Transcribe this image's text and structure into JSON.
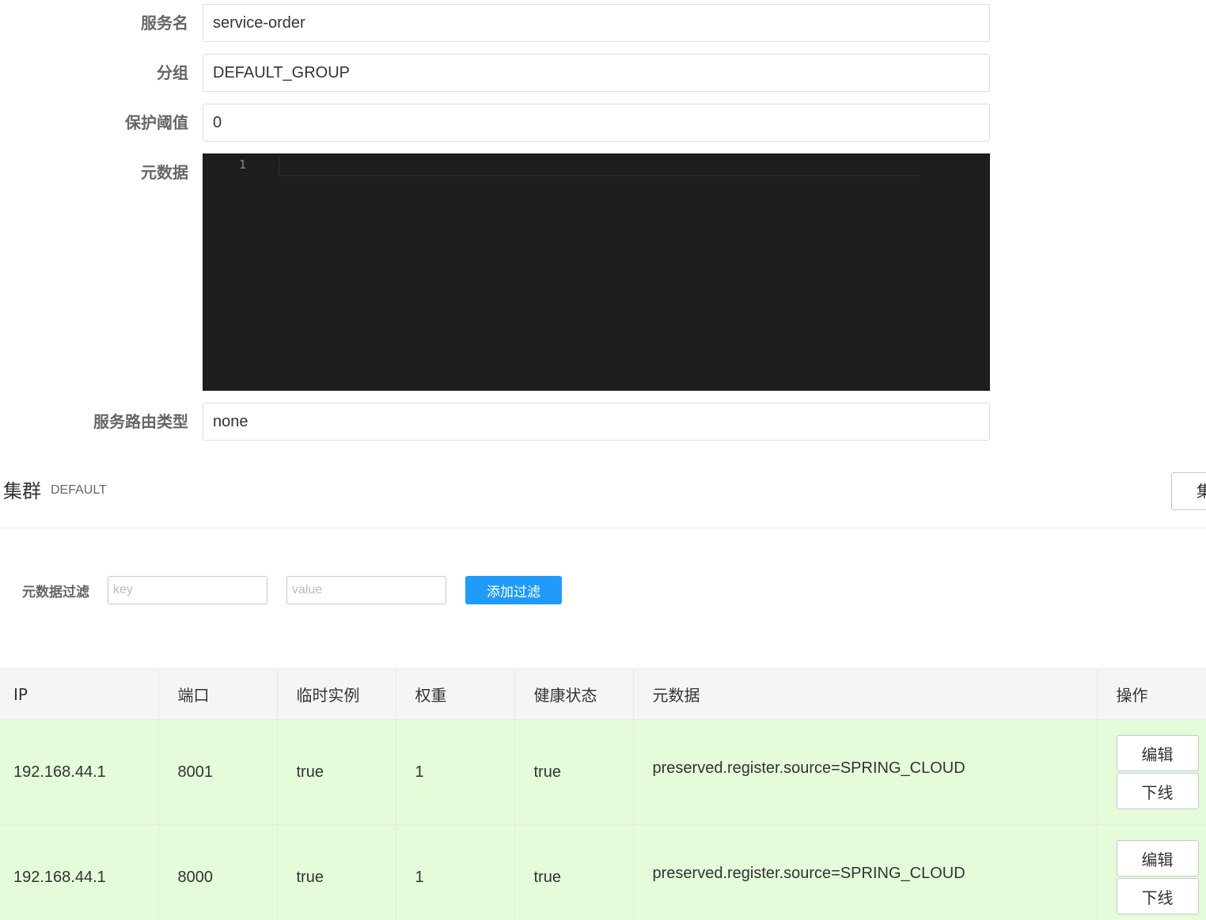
{
  "form": {
    "service_name_label": "服务名",
    "service_name_value": "service-order",
    "group_label": "分组",
    "group_value": "DEFAULT_GROUP",
    "threshold_label": "保护阈值",
    "threshold_value": "0",
    "metadata_label": "元数据",
    "metadata_line_number": "1",
    "route_type_label": "服务路由类型",
    "route_type_value": "none"
  },
  "cluster": {
    "title": "集群",
    "name": "DEFAULT",
    "config_button_label": "集"
  },
  "filter": {
    "label": "元数据过滤",
    "key_placeholder": "key",
    "value_placeholder": "value",
    "add_button_label": "添加过滤"
  },
  "table": {
    "columns": [
      "IP",
      "端口",
      "临时实例",
      "权重",
      "健康状态",
      "元数据",
      "操作"
    ],
    "rows": [
      {
        "ip": "192.168.44.1",
        "port": "8001",
        "ephemeral": "true",
        "weight": "1",
        "healthy": "true",
        "metadata": "preserved.register.source=SPRING_CLOUD"
      },
      {
        "ip": "192.168.44.1",
        "port": "8000",
        "ephemeral": "true",
        "weight": "1",
        "healthy": "true",
        "metadata": "preserved.register.source=SPRING_CLOUD"
      }
    ],
    "edit_label": "编辑",
    "offline_label": "下线"
  },
  "colors": {
    "primary": "#209bfa",
    "editor_bg": "#1e1e1e",
    "healthy_row_bg": "#e4fcda",
    "header_bg": "#f5f5f6"
  }
}
